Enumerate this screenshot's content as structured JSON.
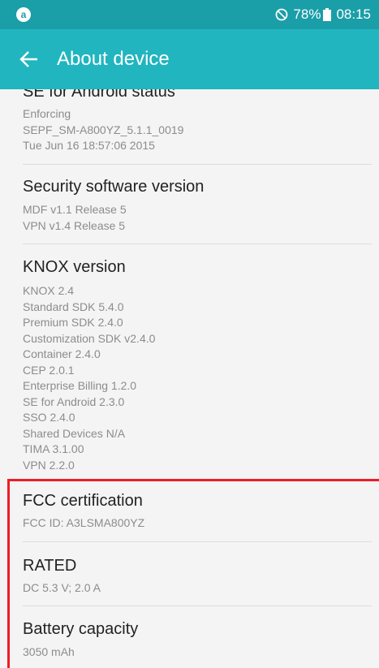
{
  "status_bar": {
    "app_icon_label": "a",
    "battery_percent": "78%",
    "time": "08:15",
    "icons": [
      "app-notification-icon",
      "do-not-disturb-icon",
      "battery-icon"
    ]
  },
  "app_bar": {
    "title": "About device",
    "back_icon": "arrow-left-icon"
  },
  "sections": [
    {
      "title": "SE for Android status",
      "lines": [
        "Enforcing",
        "SEPF_SM-A800YZ_5.1.1_0019",
        "Tue Jun 16 18:57:06 2015"
      ]
    },
    {
      "title": "Security software version",
      "lines": [
        "MDF v1.1 Release 5",
        "VPN v1.4 Release 5"
      ]
    },
    {
      "title": "KNOX version",
      "lines": [
        "KNOX 2.4",
        "Standard SDK 5.4.0",
        "Premium SDK 2.4.0",
        "Customization SDK v2.4.0",
        "Container 2.4.0",
        "CEP 2.0.1",
        "Enterprise Billing 1.2.0",
        "SE for Android 2.3.0",
        "SSO 2.4.0",
        "Shared Devices N/A",
        "TIMA 3.1.00",
        "VPN 2.2.0"
      ]
    },
    {
      "title": "FCC certification",
      "lines": [
        "FCC ID: A3LSMA800YZ"
      ]
    },
    {
      "title": "RATED",
      "lines": [
        "DC 5.3 V; 2.0 A"
      ]
    },
    {
      "title": "Battery capacity",
      "lines": [
        "3050 mAh"
      ]
    }
  ],
  "colors": {
    "status_bar": "#1a9ea8",
    "app_bar": "#21b5bf",
    "highlight": "#ee1c25",
    "background": "#f4f4f4"
  }
}
